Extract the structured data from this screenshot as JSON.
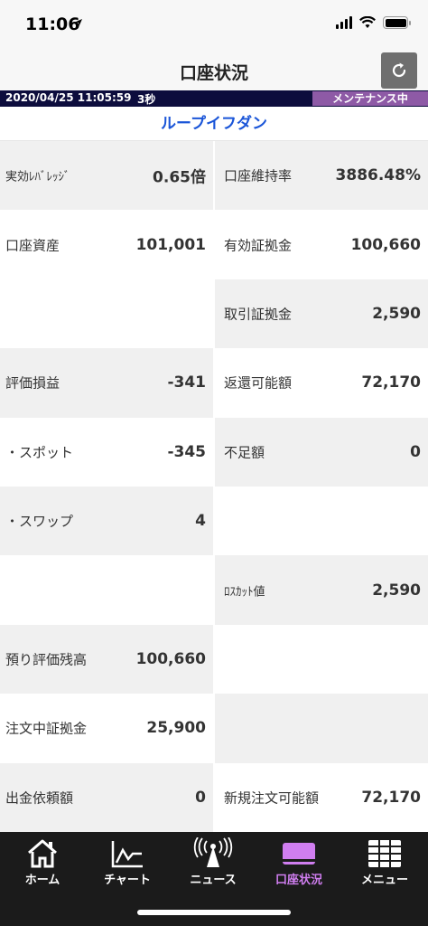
{
  "status_bar": {
    "time": "11:06"
  },
  "header": {
    "title": "口座状況",
    "refresh_icon": "refresh-icon"
  },
  "info_strip": {
    "datetime": "2020/04/25 11:05:59",
    "interval": "3秒",
    "maintenance": "メンテナンス中"
  },
  "account": {
    "name": "ループイフダン"
  },
  "rows": [
    {
      "left": {
        "label": "実効ﾚﾊﾞﾚｯｼﾞ",
        "value": "0.65倍"
      },
      "right": {
        "label": "口座維持率",
        "value": "3886.48%"
      }
    },
    {
      "left": {
        "label": "口座資産",
        "value": "101,001"
      },
      "right": {
        "label": "有効証拠金",
        "value": "100,660"
      }
    },
    {
      "left": {
        "label": "",
        "value": ""
      },
      "right": {
        "label": "取引証拠金",
        "value": "2,590"
      }
    },
    {
      "left": {
        "label": "評価損益",
        "value": "-341"
      },
      "right": {
        "label": "返還可能額",
        "value": "72,170"
      }
    },
    {
      "left": {
        "label": "・スポット",
        "value": "-345"
      },
      "right": {
        "label": "不足額",
        "value": "0"
      }
    },
    {
      "left": {
        "label": "・スワップ",
        "value": "4"
      },
      "right": {
        "label": "",
        "value": ""
      }
    },
    {
      "left": {
        "label": "",
        "value": ""
      },
      "right": {
        "label": "ﾛｽｶｯﾄ値",
        "value": "2,590"
      }
    },
    {
      "left": {
        "label": "預り評価残高",
        "value": "100,660"
      },
      "right": {
        "label": "",
        "value": ""
      }
    },
    {
      "left": {
        "label": "注文中証拠金",
        "value": "25,900"
      },
      "right": {
        "label": "",
        "value": ""
      }
    },
    {
      "left": {
        "label": "出金依頼額",
        "value": "0"
      },
      "right": {
        "label": "新規注文可能額",
        "value": "72,170"
      }
    }
  ],
  "tabs": [
    {
      "label": "ホーム",
      "icon": "home-icon"
    },
    {
      "label": "チャート",
      "icon": "chart-icon"
    },
    {
      "label": "ニュース",
      "icon": "news-icon"
    },
    {
      "label": "口座状況",
      "icon": "account-icon",
      "active": true
    },
    {
      "label": "メニュー",
      "icon": "menu-grid-icon"
    }
  ],
  "colors": {
    "accent_active_tab": "#d07ef0",
    "account_name": "#1a55d8",
    "info_strip_bg": "#0d0d3d",
    "maintenance_badge": "#8e5aa6",
    "tab_bar_bg": "#1b1b1b"
  }
}
